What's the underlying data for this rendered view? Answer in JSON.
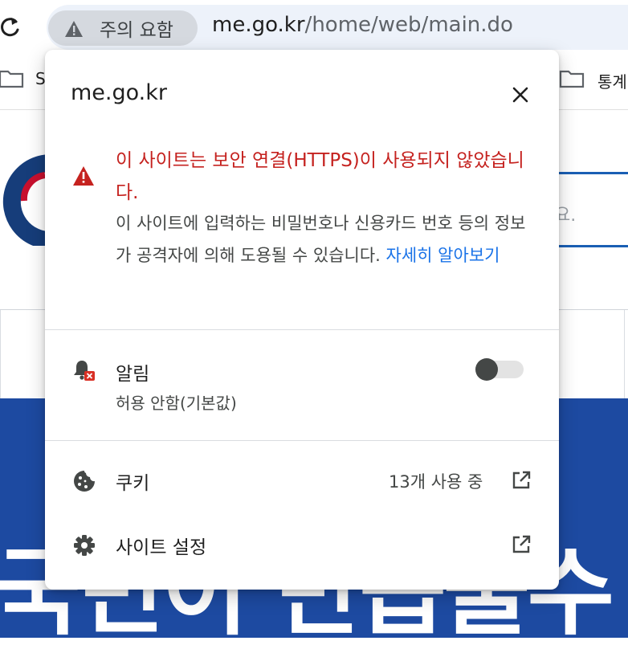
{
  "toolbar": {
    "security_chip_label": "주의 요함",
    "url_host": "me.go.kr",
    "url_path": "/home/web/main.do"
  },
  "bookmarks": {
    "left_label": "S",
    "right_label": "통계"
  },
  "page": {
    "search_hint": "요.",
    "banner_text": "국민이 만듭물수"
  },
  "popup": {
    "title": "me.go.kr",
    "warning_title": "이 사이트는 보안 연결(HTTPS)이 사용되지 않았습니다.",
    "warning_body": "이 사이트에 입력하는 비밀번호나 신용카드 번호 등의 정보가 공격자에 의해 도용될 수 있습니다.",
    "learn_more": "자세히 알아보기",
    "notifications": {
      "label": "알림",
      "sub": "허용 안함(기본값)",
      "enabled": false
    },
    "cookies": {
      "label": "쿠키",
      "count": "13개 사용 중"
    },
    "site_settings": {
      "label": "사이트 설정"
    }
  },
  "colors": {
    "warning_red": "#c5221f",
    "link_blue": "#1a73e8",
    "banner_blue": "#1d4aa1"
  },
  "icons": [
    "reload-icon",
    "warning-icon",
    "folder-icon",
    "close-icon",
    "notification-blocked-icon",
    "cookie-icon",
    "gear-icon",
    "open-external-icon"
  ]
}
